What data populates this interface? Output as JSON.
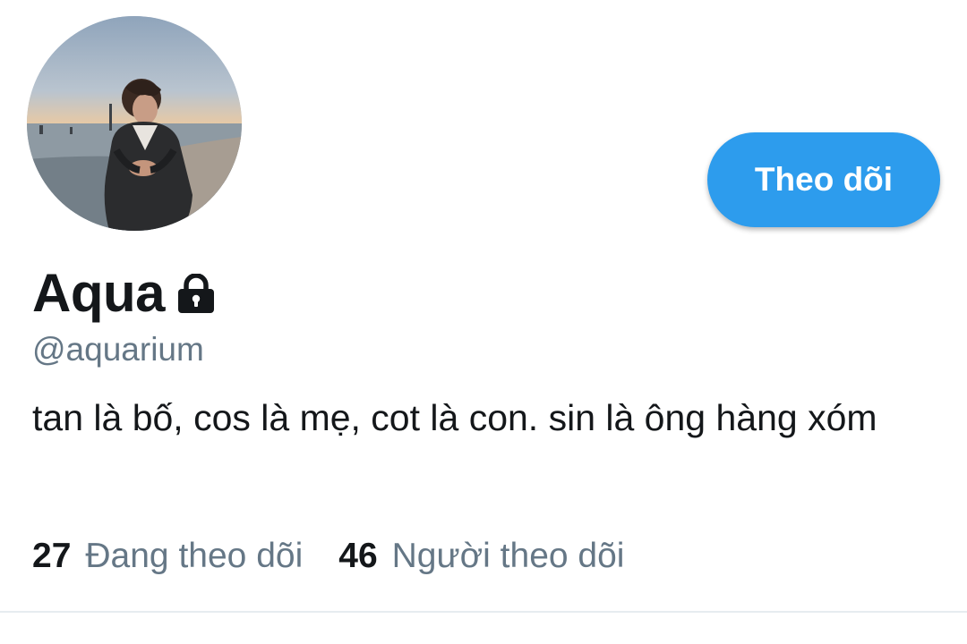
{
  "profile": {
    "display_name": "Aqua",
    "handle": "@aquarium",
    "bio": "tan là bố, cos là mẹ, cot là con. sin là ông hàng xóm",
    "protected": true
  },
  "actions": {
    "follow_label": "Theo dõi"
  },
  "stats": {
    "following_count": "27",
    "following_label": "Đang theo dõi",
    "followers_count": "46",
    "followers_label": "Người theo dõi"
  },
  "icons": {
    "lock": "lock-icon"
  },
  "colors": {
    "accent": "#2d9ced",
    "text_primary": "#14171a",
    "text_secondary": "#657786",
    "divider": "#e6ecf0"
  }
}
